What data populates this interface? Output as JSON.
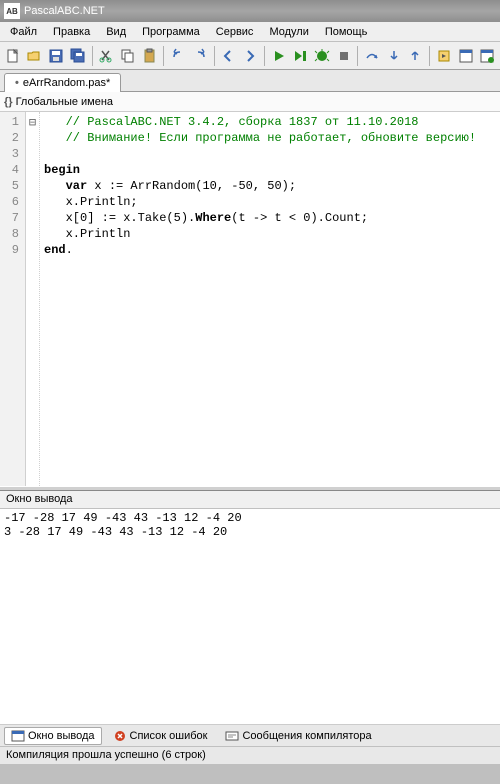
{
  "window": {
    "title": "PascalABC.NET"
  },
  "menu": {
    "file": "Файл",
    "edit": "Правка",
    "view": "Вид",
    "program": "Программа",
    "service": "Сервис",
    "modules": "Модули",
    "help": "Помощь"
  },
  "tab": {
    "name": "eArrRandom.pas*"
  },
  "globals": {
    "label": "Глобальные имена"
  },
  "code": {
    "lines": [
      {
        "n": 1,
        "fold": "",
        "html": "   <span class='c-comment'>// PascalABC.NET 3.4.2, сборка 1837 от 11.10.2018</span>"
      },
      {
        "n": 2,
        "fold": "",
        "html": "   <span class='c-comment'>// Внимание! Если программа не работает, обновите версию!</span>"
      },
      {
        "n": 3,
        "fold": "",
        "html": ""
      },
      {
        "n": 4,
        "fold": "⊟",
        "html": "<span class='c-kw'>begin</span>"
      },
      {
        "n": 5,
        "fold": "",
        "html": "   <span class='c-kw'>var</span> x := ArrRandom(<span class='c-num'>10</span>, -<span class='c-num'>50</span>, <span class='c-num'>50</span>);"
      },
      {
        "n": 6,
        "fold": "",
        "html": "   x.Println;"
      },
      {
        "n": 7,
        "fold": "",
        "html": "   x[<span class='c-num'>0</span>] := x.Take(<span class='c-num'>5</span>).<span class='c-kw'>Where</span>(t -> t &lt; <span class='c-num'>0</span>).Count;"
      },
      {
        "n": 8,
        "fold": "",
        "html": "   x.Println"
      },
      {
        "n": 9,
        "fold": "",
        "html": "<span class='c-kw'>end</span>."
      }
    ]
  },
  "output": {
    "title": "Окно вывода",
    "lines": [
      "-17 -28 17 49 -43 43 -13 12 -4 20",
      "3 -28 17 49 -43 43 -13 12 -4 20"
    ]
  },
  "bottomTabs": {
    "output": "Окно вывода",
    "errors": "Список ошибок",
    "compiler": "Сообщения компилятора"
  },
  "status": {
    "text": "Компиляция прошла успешно (6 строк)"
  }
}
